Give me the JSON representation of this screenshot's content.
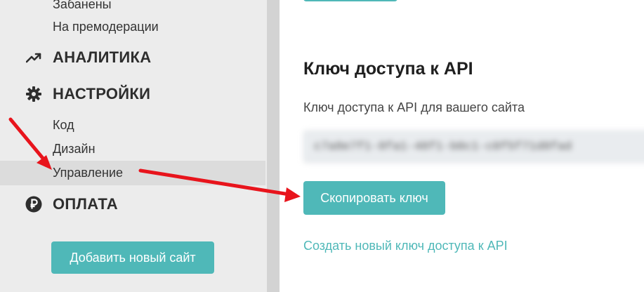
{
  "sidebar": {
    "top_items": [
      {
        "label": "Забанены"
      },
      {
        "label": "На премодерации"
      }
    ],
    "sections": [
      {
        "label": "АНАЛИТИКА",
        "icon": "trending-up-icon"
      },
      {
        "label": "НАСТРОЙКИ",
        "icon": "gear-icon"
      },
      {
        "label": "ОПЛАТА",
        "icon": "ruble-icon"
      }
    ],
    "settings_items": [
      {
        "label": "Код"
      },
      {
        "label": "Дизайн"
      },
      {
        "label": "Управление",
        "active": true
      }
    ],
    "add_site_label": "Добавить новый сайт"
  },
  "main": {
    "title": "Ключ доступа к API",
    "description": "Ключ доступа к API для вашего сайта",
    "api_key_value": "c7a8e7f1-8fa1-48f1-b0c1-c0f5f71d8fad",
    "copy_label": "Скопировать ключ",
    "create_link": "Создать новый ключ доступа к API"
  },
  "colors": {
    "accent": "#4fb8b8",
    "arrow": "#e8141c",
    "sidebar_bg": "#ececec"
  }
}
